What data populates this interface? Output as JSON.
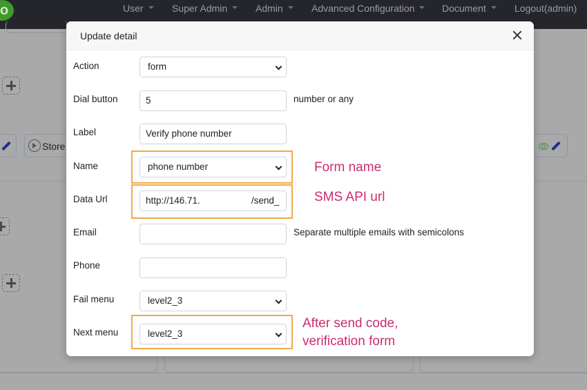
{
  "navbar": {
    "logo_text": "o",
    "items": [
      {
        "label": "User",
        "has_dropdown": true
      },
      {
        "label": "Super Admin",
        "has_dropdown": true
      },
      {
        "label": "Admin",
        "has_dropdown": true
      },
      {
        "label": "Advanced Configuration",
        "has_dropdown": true
      },
      {
        "label": "Document",
        "has_dropdown": true
      },
      {
        "label": "Logout(admin)",
        "has_dropdown": false
      }
    ]
  },
  "background": {
    "store_button_label": "Store",
    "icons": [
      "plus-icon",
      "pencil-icon",
      "play-circle-icon",
      "eye-icon"
    ]
  },
  "modal": {
    "title": "Update detail",
    "close_icon": "close-icon",
    "fields": {
      "action": {
        "label": "Action",
        "type": "select",
        "value": "form"
      },
      "dial_button": {
        "label": "Dial button",
        "type": "text",
        "value": "5",
        "helper": "number or any"
      },
      "label": {
        "label": "Label",
        "type": "text",
        "value": "Verify phone number"
      },
      "name": {
        "label": "Name",
        "type": "select",
        "value": "phone number"
      },
      "data_url": {
        "label": "Data Url",
        "type": "text",
        "value_start": "http://146.71.",
        "value_end": "/send_"
      },
      "email": {
        "label": "Email",
        "type": "text",
        "value": "",
        "helper": "Separate multiple emails with semicolons"
      },
      "phone": {
        "label": "Phone",
        "type": "text",
        "value": ""
      },
      "fail_menu": {
        "label": "Fail menu",
        "type": "select",
        "value": "level2_3"
      },
      "next_menu": {
        "label": "Next menu",
        "type": "select",
        "value": "level2_3"
      }
    }
  },
  "annotations": {
    "form_name": "Form name",
    "sms_api_url": "SMS API url",
    "next_menu_line1": "After send code,",
    "next_menu_line2": "verification form",
    "highlight_color": "#f0a848",
    "text_color": "#cc2b6e"
  }
}
